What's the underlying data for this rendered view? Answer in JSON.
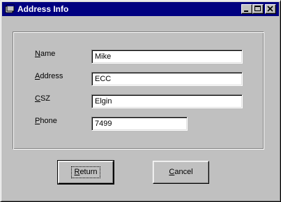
{
  "window": {
    "title": "Address Info",
    "icon": "form-icon",
    "controls": [
      "minimize-icon",
      "maximize-icon",
      "close-icon"
    ]
  },
  "form": {
    "fields": [
      {
        "label_accel": "N",
        "label_rest": "ame",
        "value": "Mike"
      },
      {
        "label_accel": "A",
        "label_rest": "ddress",
        "value": "ECC"
      },
      {
        "label_accel": "C",
        "label_rest": "SZ",
        "value": "Elgin"
      },
      {
        "label_accel": "P",
        "label_rest": "hone",
        "value": "7499"
      }
    ]
  },
  "buttons": {
    "return": {
      "accel": "R",
      "rest": "eturn"
    },
    "cancel": {
      "accel": "C",
      "rest": "ancel"
    }
  },
  "colors": {
    "titlebar": "#000080",
    "face": "#c0c0c0"
  }
}
